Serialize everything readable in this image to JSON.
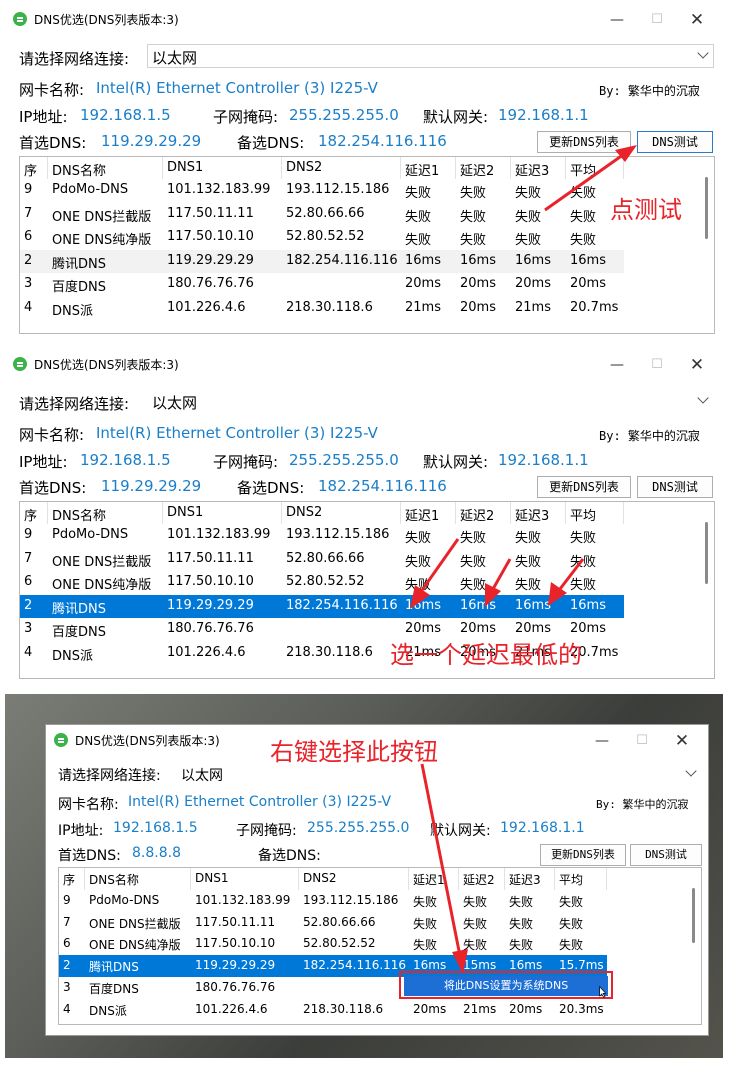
{
  "window": {
    "title": "DNS优选(DNS列表版本:3)",
    "min_glyph": "—",
    "max_glyph": "☐",
    "close_glyph": "✕"
  },
  "form": {
    "connection_label": "请选择网络连接:",
    "connection_value": "以太网",
    "adapter_label": "网卡名称:",
    "adapter_value": "Intel(R) Ethernet Controller (3) I225-V",
    "author": "By: 繁华中的沉寂",
    "ip_label": "IP地址:",
    "ip_value": "192.168.1.5",
    "mask_label": "子网掩码:",
    "mask_value": "255.255.255.0",
    "gateway_label": "默认网关:",
    "gateway_value": "192.168.1.1",
    "primary_label": "首选DNS:",
    "primary_value": "119.29.29.29",
    "secondary_label": "备选DNS:",
    "secondary_value": "182.254.116.116",
    "primary_value_after": "8.8.8.8",
    "secondary_value_after": ""
  },
  "buttons": {
    "update_list": "更新DNS列表",
    "test_dns": "DNS测试"
  },
  "table": {
    "columns": [
      "序",
      "DNS名称",
      "DNS1",
      "DNS2",
      "延迟1",
      "延迟2",
      "延迟3",
      "平均"
    ],
    "rows": [
      [
        "9",
        "PdoMo-DNS",
        "101.132.183.99",
        "193.112.15.186",
        "失败",
        "失败",
        "失败",
        "失败"
      ],
      [
        "7",
        "ONE DNS拦截版",
        "117.50.11.11",
        "52.80.66.66",
        "失败",
        "失败",
        "失败",
        "失败"
      ],
      [
        "6",
        "ONE DNS纯净版",
        "117.50.10.10",
        "52.80.52.52",
        "失败",
        "失败",
        "失败",
        "失败"
      ],
      [
        "2",
        "腾讯DNS",
        "119.29.29.29",
        "182.254.116.116",
        "16ms",
        "16ms",
        "16ms",
        "16ms"
      ],
      [
        "3",
        "百度DNS",
        "180.76.76.76",
        "",
        "20ms",
        "20ms",
        "20ms",
        "20ms"
      ],
      [
        "4",
        "DNS派",
        "101.226.4.6",
        "218.30.118.6",
        "21ms",
        "20ms",
        "21ms",
        "20.7ms"
      ]
    ],
    "rows_panel3": [
      [
        "9",
        "PdoMo-DNS",
        "101.132.183.99",
        "193.112.15.186",
        "失败",
        "失败",
        "失败",
        "失败"
      ],
      [
        "7",
        "ONE DNS拦截版",
        "117.50.11.11",
        "52.80.66.66",
        "失败",
        "失败",
        "失败",
        "失败"
      ],
      [
        "6",
        "ONE DNS纯净版",
        "117.50.10.10",
        "52.80.52.52",
        "失败",
        "失败",
        "失败",
        "失败"
      ],
      [
        "2",
        "腾讯DNS",
        "119.29.29.29",
        "182.254.116.116",
        "16ms",
        "15ms",
        "16ms",
        "15.7ms"
      ],
      [
        "3",
        "百度DNS",
        "180.76.76.76",
        "",
        "",
        "",
        "",
        ""
      ],
      [
        "4",
        "DNS派",
        "101.226.4.6",
        "218.30.118.6",
        "20ms",
        "21ms",
        "20ms",
        "20.3ms"
      ]
    ]
  },
  "context_menu": {
    "set_system_dns": "将此DNS设置为系统DNS"
  },
  "annotations": {
    "step1": "点测试",
    "step2": "选一个延迟最低的",
    "step3": "右键选择此按钮"
  },
  "colors": {
    "accent": "#1a7ec8",
    "selection": "#0078d7",
    "annotation": "#e8232a"
  }
}
